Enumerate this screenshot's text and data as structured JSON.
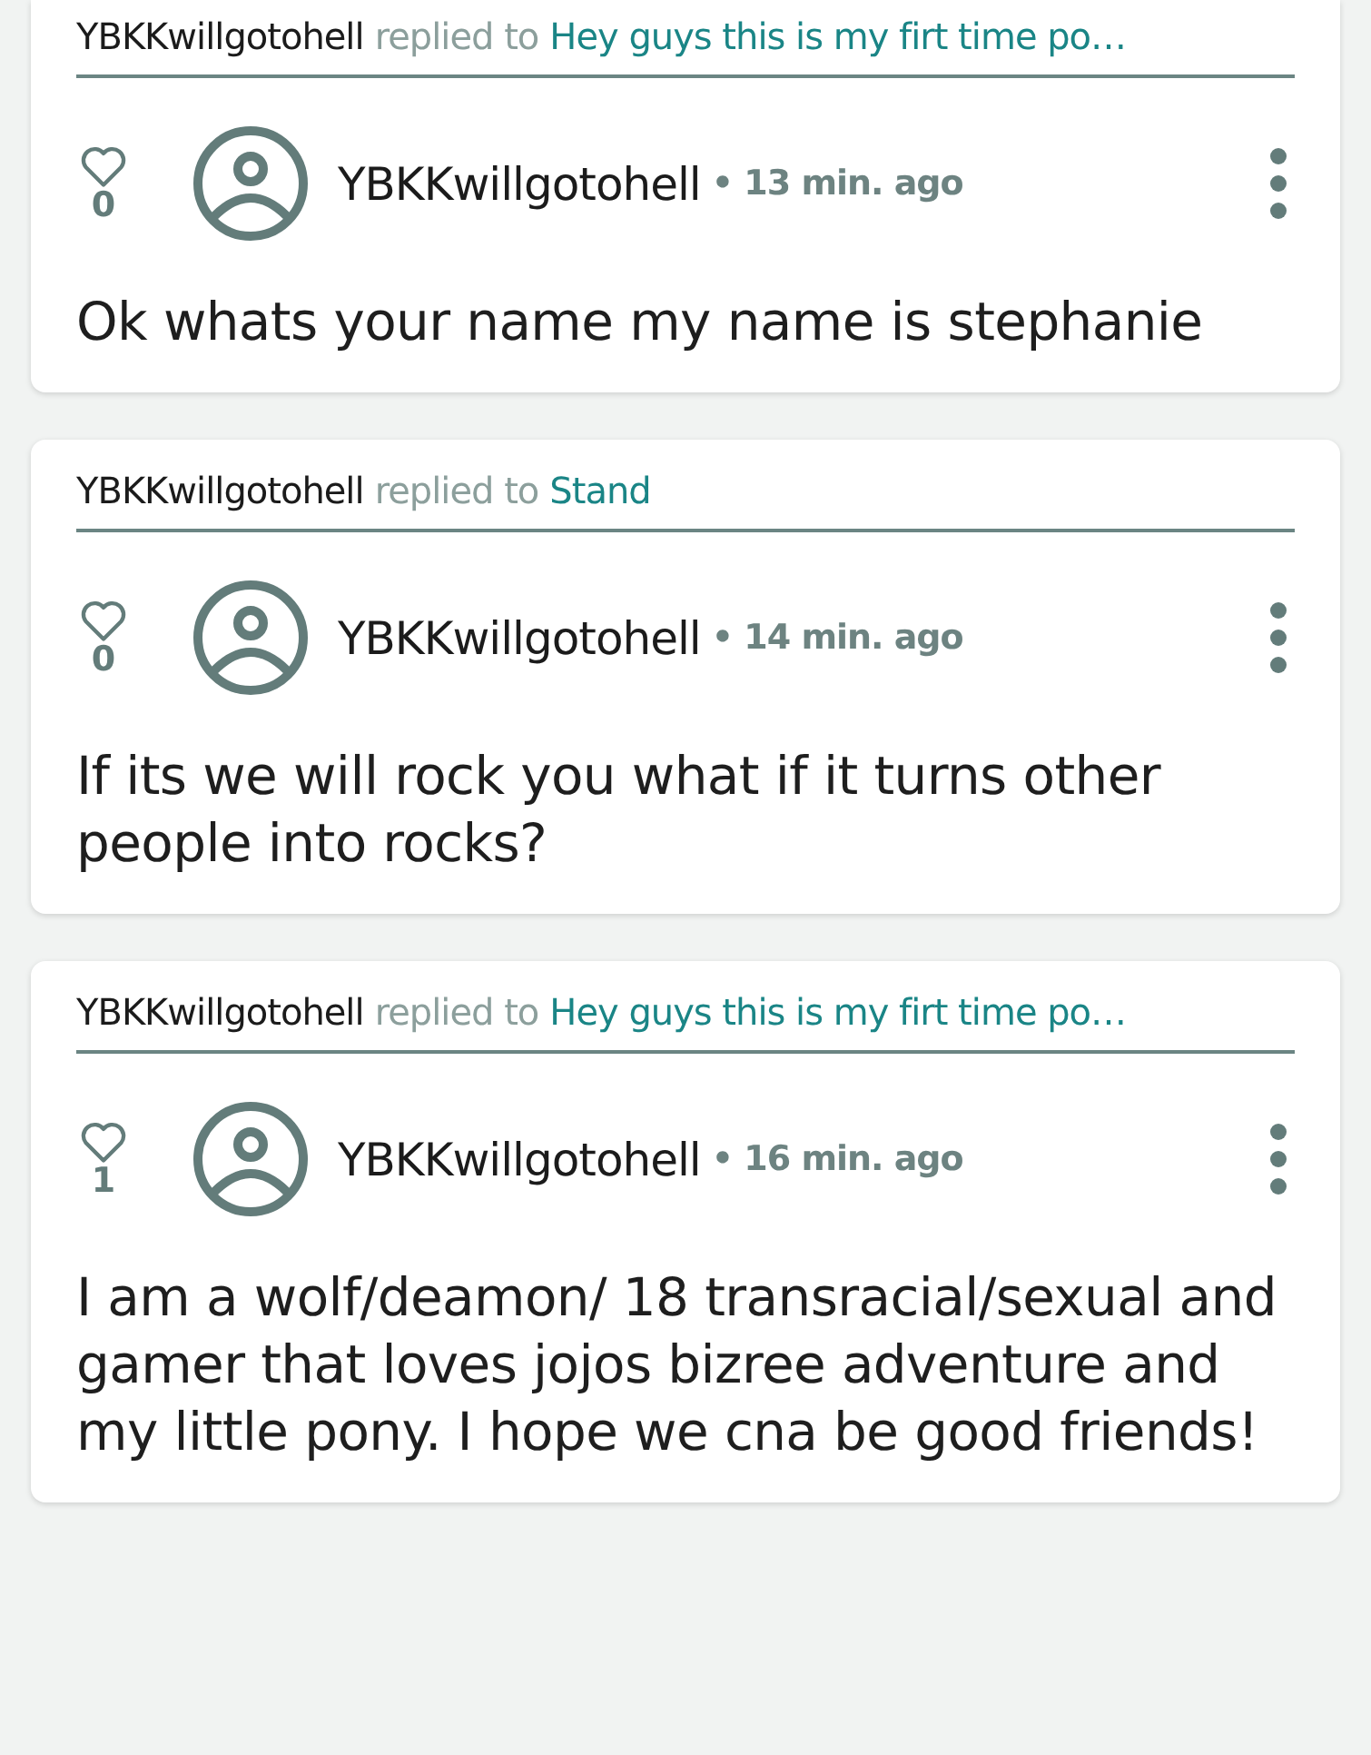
{
  "comments": [
    {
      "author": "YBKKwillgotohell",
      "replied": "replied to",
      "target": "Hey guys this is my firt time po…",
      "likes": "0",
      "user": "YBKKwillgotohell",
      "time": "• 13 min. ago",
      "body": "Ok whats your name my name is stephanie"
    },
    {
      "author": "YBKKwillgotohell",
      "replied": "replied to",
      "target": "Stand",
      "likes": "0",
      "user": "YBKKwillgotohell",
      "time": "• 14 min. ago",
      "body": "If its we will rock you what if it turns other people into rocks?"
    },
    {
      "author": "YBKKwillgotohell",
      "replied": "replied to",
      "target": "Hey guys this is my firt time po…",
      "likes": "1",
      "user": "YBKKwillgotohell",
      "time": "• 16 min. ago",
      "body": "I am a wolf/deamon/ 18 transracial/sexual and gamer that loves jojos bizree adventure and my little pony. I hope we cna be good friends!"
    }
  ]
}
